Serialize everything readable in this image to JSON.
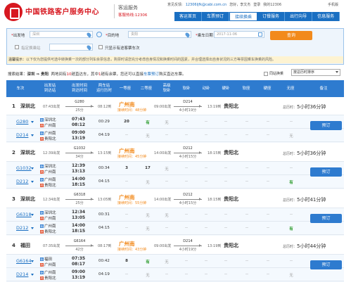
{
  "header": {
    "brand_title": "中国铁路客户服务中心",
    "brand_sub": "客运服务",
    "brand_phone": "客服热线:12306",
    "user_email": "12306ljfk@cabi.com.cn",
    "user_greeting": "您好，李文杰",
    "user_bar_prefix": "意见反馈:",
    "login_label": "登录",
    "my_account": "我的12306",
    "mobile": "手机版",
    "nav": [
      "客运首页",
      "车票预订",
      "接续换乘",
      "订餐服务",
      "出行向导",
      "信息服务"
    ],
    "nav_active_index": 2
  },
  "search": {
    "from_label": "出发地",
    "from_value": "深圳",
    "to_label": "目的地",
    "to_value": "贵阳",
    "date_label": "乘车日期",
    "date_value": "2017-11-06",
    "query_button": "查询",
    "transfer_station_label": "指定换乘站",
    "hint_checkbox_label": "只显示有途客票车次",
    "notice_prefix": "温馨提示：",
    "notice_text": "以下仅为您提供可选中转换乘一次的部分列车余票信息，购票时请您充分考虑自身情况和换乘时间的因素，并合理选择出自身状况的三方等票因乘车换乘的风险。"
  },
  "result": {
    "info": {
      "prefix": "搜索结果：",
      "route": "深圳 ⇒ 贵阳",
      "count_prefix": "两地间有",
      "count_total": "10",
      "count_mid": "趟直达车，其中",
      "count_avail": "1",
      "count_suffix": "趟有余票，您还可以直接",
      "link": "车票预订",
      "tail": "购买直达车票。"
    },
    "transfer_checkbox": "同站换乘",
    "sort_value": "按总历时排序"
  },
  "table_headers": [
    "车次",
    "出发站\n到达站",
    "出发时间\n到达时间",
    "两车站\n运行历时",
    "一等座",
    "二等座",
    "高级\n软卧",
    "软卧",
    "动卧",
    "硬卧",
    "软座",
    "硬座",
    "无座",
    "备注"
  ],
  "groups": [
    {
      "num": "1",
      "station": "深圳北",
      "dep_time": "07:43出发",
      "train1": "G280",
      "dur1": "25分",
      "arr_mid": "08:12到",
      "transfer_city": "广州南",
      "wait": "接续时间：48分钟",
      "dep2": "09:00出发",
      "train2": "D214",
      "dur2": "4小时19分",
      "arr_time": "13:19到",
      "arr_city": "贵阳北",
      "total_prefix": "总历时：",
      "total": "5小时36分钟",
      "rows": [
        {
          "train": "G280",
          "from": "深圳北",
          "to": "广州南",
          "dep": "07:43",
          "arr": "08:12",
          "dur": "00:29",
          "first": "20",
          "second": "有",
          "cells": [
            "无",
            "--",
            "--",
            "--",
            "--",
            "--",
            "--"
          ]
        },
        {
          "train": "D214",
          "from": "广州南",
          "to": "贵阳北",
          "dep": "09:00",
          "arr": "13:19",
          "dur": "04:19",
          "first": "--",
          "second": "无",
          "cells": [
            "--",
            "--",
            "--",
            "--",
            "--",
            "--",
            "无"
          ]
        }
      ],
      "book": "预订"
    },
    {
      "num": "2",
      "station": "深圳北",
      "dep_time": "12:39出发",
      "train1": "G1032",
      "dur1": "34分",
      "arr_mid": "13:15到",
      "transfer_city": "广州南",
      "wait": "接续时间：45分钟",
      "dep2": "14:00出发",
      "train2": "D212",
      "dur2": "4小时15分",
      "arr_time": "18:15到",
      "arr_city": "贵阳北",
      "total_prefix": "总历时：",
      "total": "5小时36分钟",
      "rows": [
        {
          "train": "G1032",
          "from": "深圳北",
          "to": "广州南",
          "dep": "12:39",
          "arr": "13:13",
          "dur": "00:34",
          "first": "3",
          "second": "17",
          "cells": [
            "无",
            "--",
            "--",
            "--",
            "--",
            "--",
            "--"
          ]
        },
        {
          "train": "D212",
          "from": "广州南",
          "to": "贵阳北",
          "dep": "14:00",
          "arr": "18:15",
          "dur": "04:15",
          "first": "--",
          "second": "无",
          "cells": [
            "--",
            "--",
            "--",
            "--",
            "--",
            "--",
            "有"
          ]
        }
      ],
      "book": "预订"
    },
    {
      "num": "3",
      "station": "深圳北",
      "dep_time": "12:34出发",
      "train1": "G6318",
      "dur1": "25分",
      "arr_mid": "13:05到",
      "transfer_city": "广州南",
      "wait": "接续时间：55分钟",
      "dep2": "14:00出发",
      "train2": "D212",
      "dur2": "4小时15分",
      "arr_time": "18:15到",
      "arr_city": "贵阳北",
      "total_prefix": "总历时：",
      "total": "5小时41分钟",
      "rows": [
        {
          "train": "G6318",
          "from": "深圳北",
          "to": "广州南",
          "dep": "12:34",
          "arr": "13:05",
          "dur": "00:31",
          "first": "--",
          "second": "无",
          "cells": [
            "无",
            "--",
            "--",
            "--",
            "--",
            "--",
            "--"
          ]
        },
        {
          "train": "D212",
          "from": "广州南",
          "to": "贵阳北",
          "dep": "14:00",
          "arr": "18:15",
          "dur": "04:15",
          "first": "--",
          "second": "无",
          "cells": [
            "--",
            "--",
            "--",
            "--",
            "--",
            "--",
            "有"
          ]
        }
      ],
      "book": "预订"
    },
    {
      "num": "4",
      "station": "福田",
      "dep_time": "07:35出发",
      "train1": "G6164",
      "dur1": "42分",
      "arr_mid": "08:17到",
      "transfer_city": "广州南",
      "wait": "接续时间：43分钟",
      "dep2": "09:00出发",
      "train2": "D214",
      "dur2": "4小时19分",
      "arr_time": "13:19到",
      "arr_city": "贵阳北",
      "total_prefix": "总历时：",
      "total": "5小时44分钟",
      "rows": [
        {
          "train": "G6164",
          "from": "福田",
          "to": "广州南",
          "dep": "07:35",
          "arr": "08:17",
          "dur": "00:42",
          "first": "8",
          "second": "有",
          "cells": [
            "无",
            "--",
            "--",
            "--",
            "--",
            "--",
            "--"
          ]
        },
        {
          "train": "D214",
          "from": "广州南",
          "to": "贵阳北",
          "dep": "09:00",
          "arr": "13:19",
          "dur": "04:19",
          "first": "--",
          "second": "无",
          "cells": [
            "--",
            "--",
            "--",
            "--",
            "--",
            "--",
            "无"
          ]
        }
      ],
      "book": "预订"
    }
  ],
  "colors": {
    "brand_red": "#d71820",
    "primary_blue": "#2e7bcf",
    "orange": "#f28a1c",
    "avail_green": "#2a9b2a"
  }
}
